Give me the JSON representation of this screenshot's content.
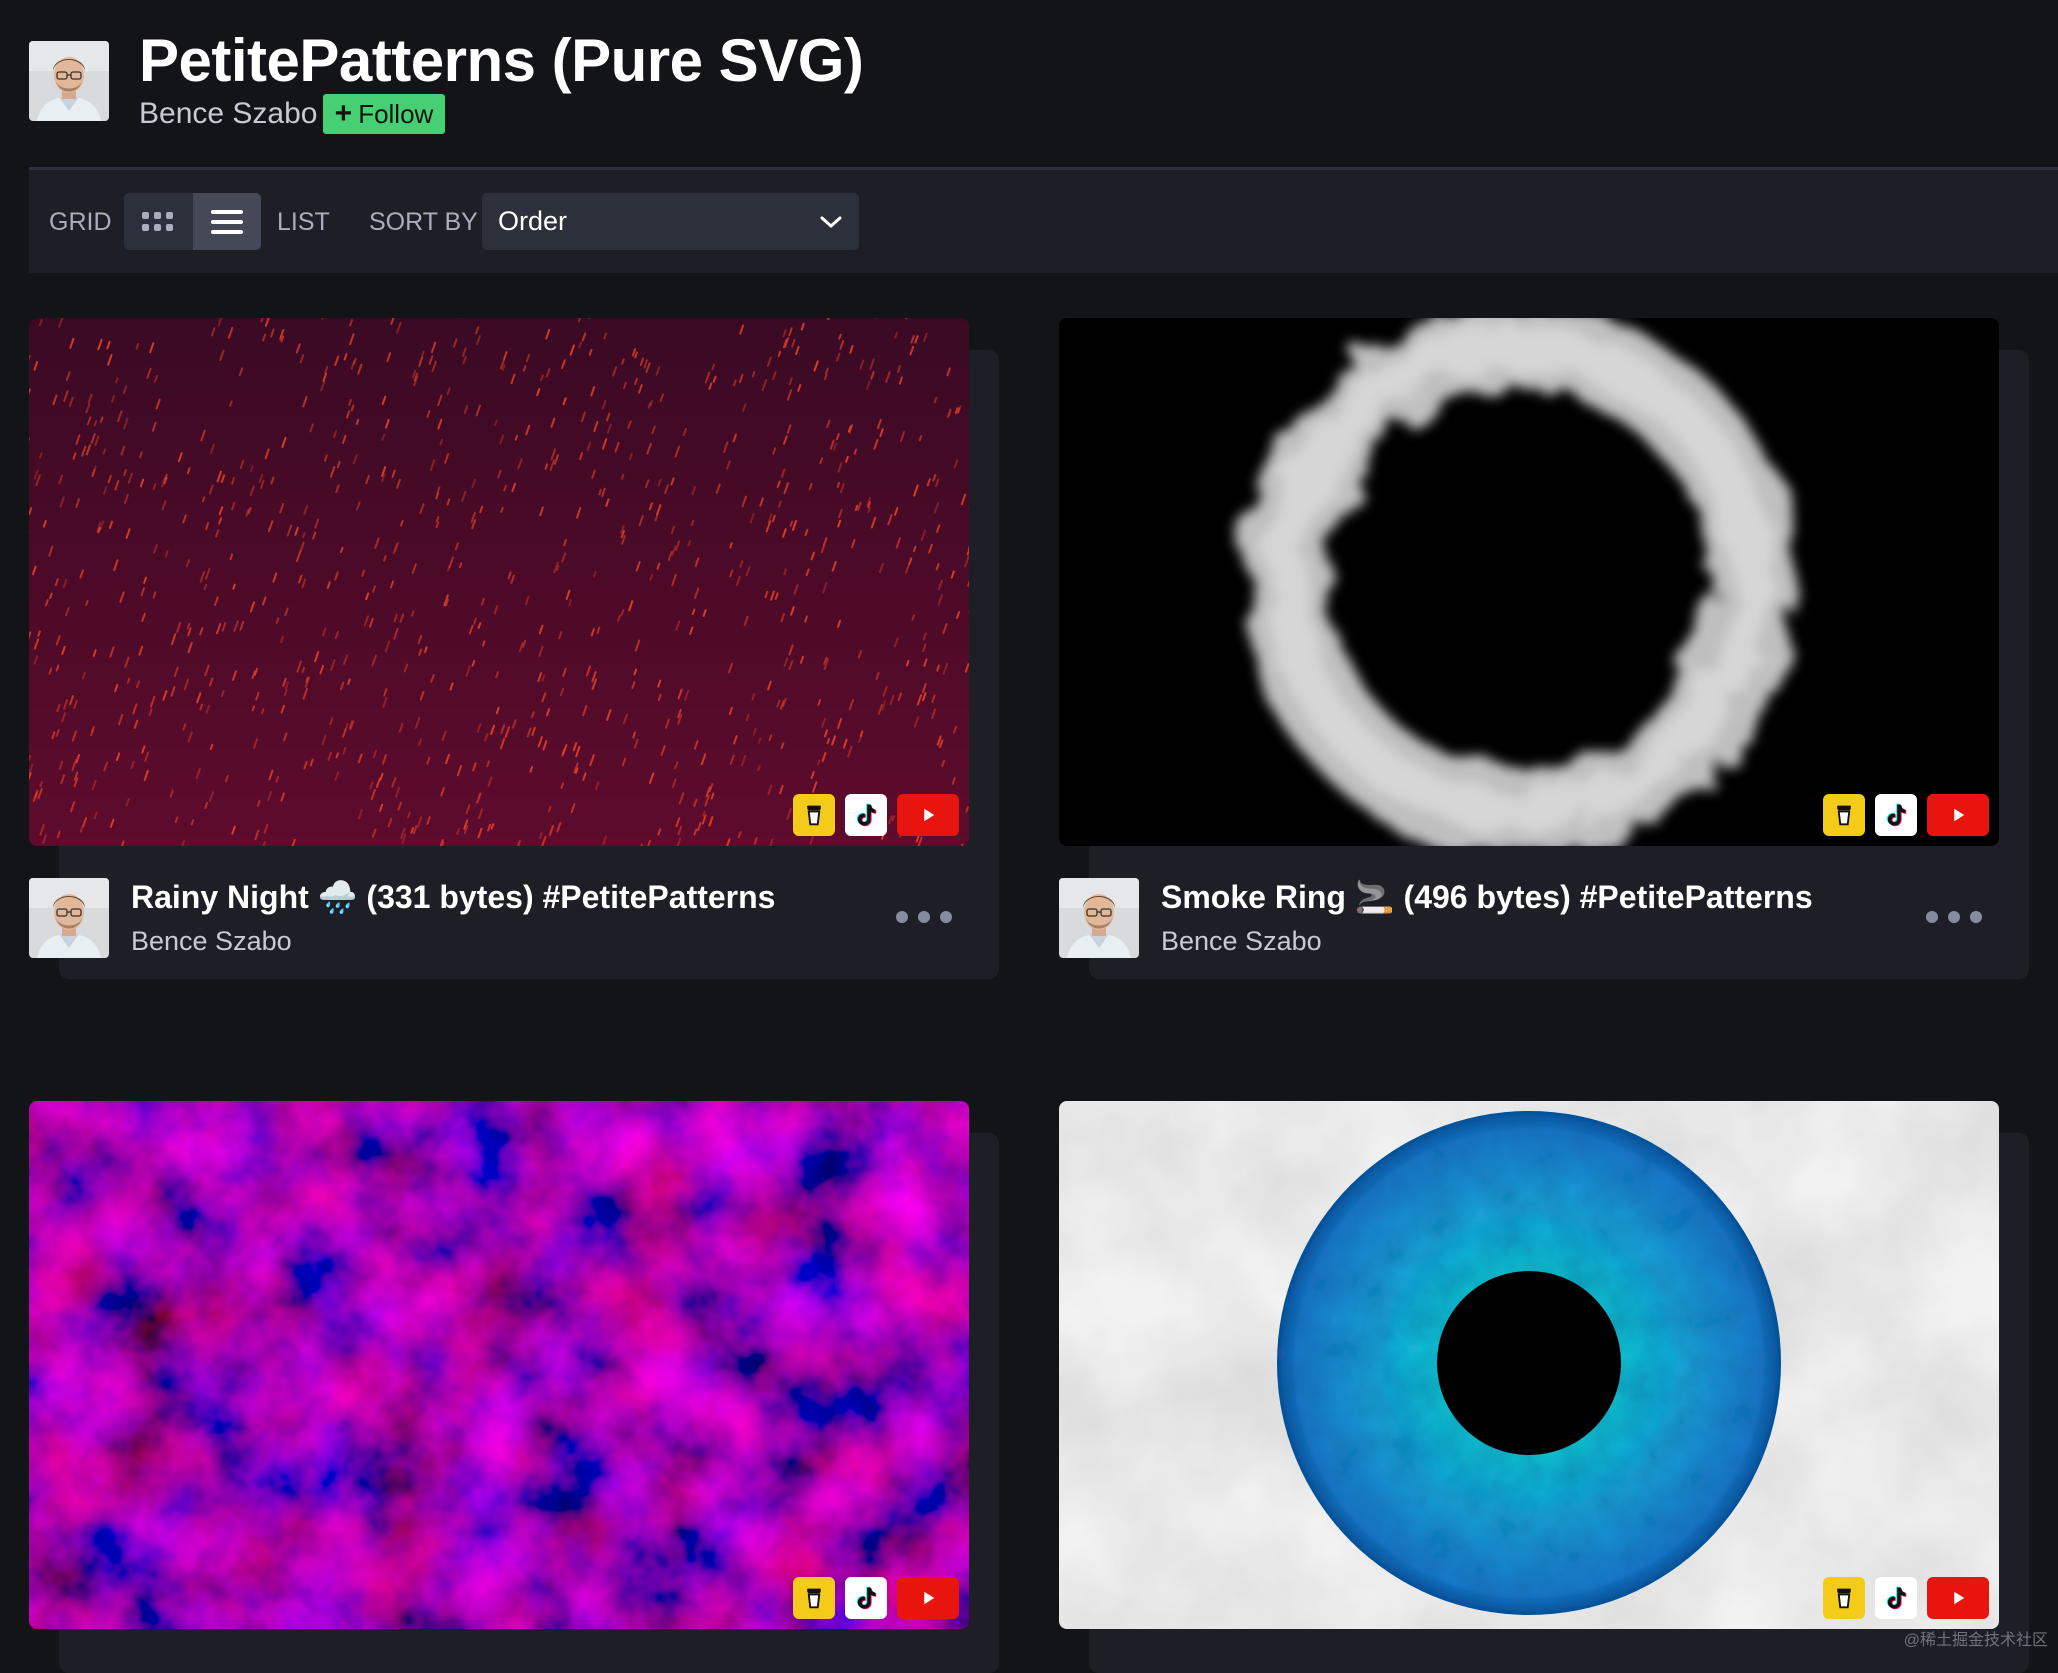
{
  "header": {
    "title": "PetitePatterns (Pure SVG)",
    "author": "Bence Szabo",
    "follow_label": "Follow",
    "follow_color": "#47cf73"
  },
  "toolbar": {
    "grid_label": "GRID",
    "list_label": "LIST",
    "sort_by_label": "SORT BY",
    "sort_value": "Order",
    "active_view": "list"
  },
  "cards": [
    {
      "title": "Rainy Night 🌧️ (331 bytes) #PetitePatterns",
      "author": "Bence Szabo"
    },
    {
      "title": "Smoke Ring 🚬 (496 bytes) #PetitePatterns",
      "author": "Bence Szabo"
    },
    {
      "title": "",
      "author": ""
    },
    {
      "title": "",
      "author": ""
    }
  ],
  "card_icons": [
    "buy-me-a-coffee-icon",
    "tiktok-icon",
    "youtube-icon",
    "more-options-icon"
  ],
  "watermark": "@稀土掘金技术社区"
}
